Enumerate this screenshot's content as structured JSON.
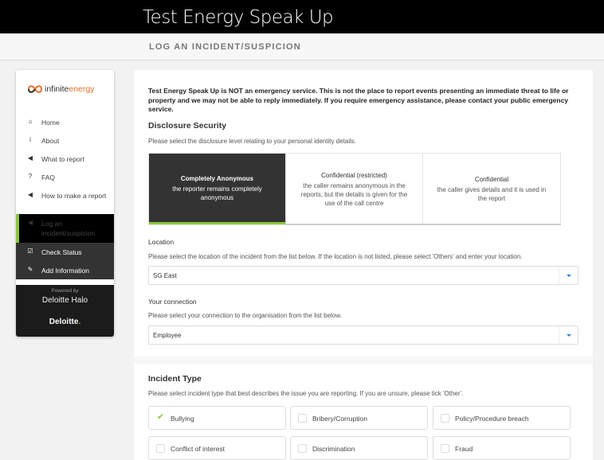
{
  "header": {
    "title": "Test Energy Speak Up",
    "subtitle": "LOG AN INCIDENT/SUSPICION"
  },
  "sidebar": {
    "logo": {
      "brand_main": "infinite",
      "brand_accent": "energy"
    },
    "items": [
      {
        "label": "Home",
        "icon": "home-icon",
        "glyph": "⌂"
      },
      {
        "label": "About",
        "icon": "info-icon",
        "glyph": "i"
      },
      {
        "label": "What to report",
        "icon": "megaphone-icon",
        "glyph": "◀"
      },
      {
        "label": "FAQ",
        "icon": "question-icon",
        "glyph": "?"
      },
      {
        "label": "How to make a report",
        "icon": "megaphone-icon",
        "glyph": "◀"
      },
      {
        "label": "Log an incident/suspicion",
        "icon": "megaphone-icon",
        "glyph": "◀"
      },
      {
        "label": "Check Status",
        "icon": "checkbox-icon",
        "glyph": "☑"
      },
      {
        "label": "Add Information",
        "icon": "edit-icon",
        "glyph": "✎"
      }
    ],
    "powered_by": "Powered by",
    "product": "Deloitte Halo",
    "company": "Deloitte",
    "company_dot": "."
  },
  "notice": "Test Energy Speak Up is NOT an emergency service. This is not the place to report events presenting an immediate threat to life or property and we may not be able to reply immediately. If you require emergency assistance, please contact your public emergency service.",
  "disclosure": {
    "heading": "Disclosure Security",
    "help": "Please select the disclosure level relating to your personal identity details.",
    "options": [
      {
        "title": "Completely Anonymous",
        "desc": "the reporter remains completely anonymous",
        "selected": true
      },
      {
        "title": "Confidential (restricted)",
        "desc": "the caller remains anonymous in the reports, but the details is given for the use of the call centre",
        "selected": false
      },
      {
        "title": "Confidential",
        "desc": "the caller gives details and it is used in the report",
        "selected": false
      }
    ]
  },
  "location": {
    "label": "Location",
    "help": "Please select the location of the incident from the list below. If the location is not listed, please select 'Others' and enter your location.",
    "value": "SG East"
  },
  "connection": {
    "label": "Your connection",
    "help": "Please select your connection to the organisation from the list below.",
    "value": "Employee"
  },
  "incident_type": {
    "heading": "Incident Type",
    "help": "Please select incident type that best describes the issue you are reporting. If you are unsure, please tick 'Other'.",
    "options": [
      {
        "label": "Bullying",
        "checked": true
      },
      {
        "label": "Bribery/Corruption",
        "checked": false
      },
      {
        "label": "Policy/Procedure breach",
        "checked": false
      },
      {
        "label": "Conflict of interest",
        "checked": false
      },
      {
        "label": "Discrimination",
        "checked": false
      },
      {
        "label": "Fraud",
        "checked": false
      }
    ]
  },
  "colors": {
    "accent_green": "#8cc63f",
    "brand_orange": "#e8702a",
    "dark": "#333333",
    "link_blue": "#2a7fd4"
  }
}
